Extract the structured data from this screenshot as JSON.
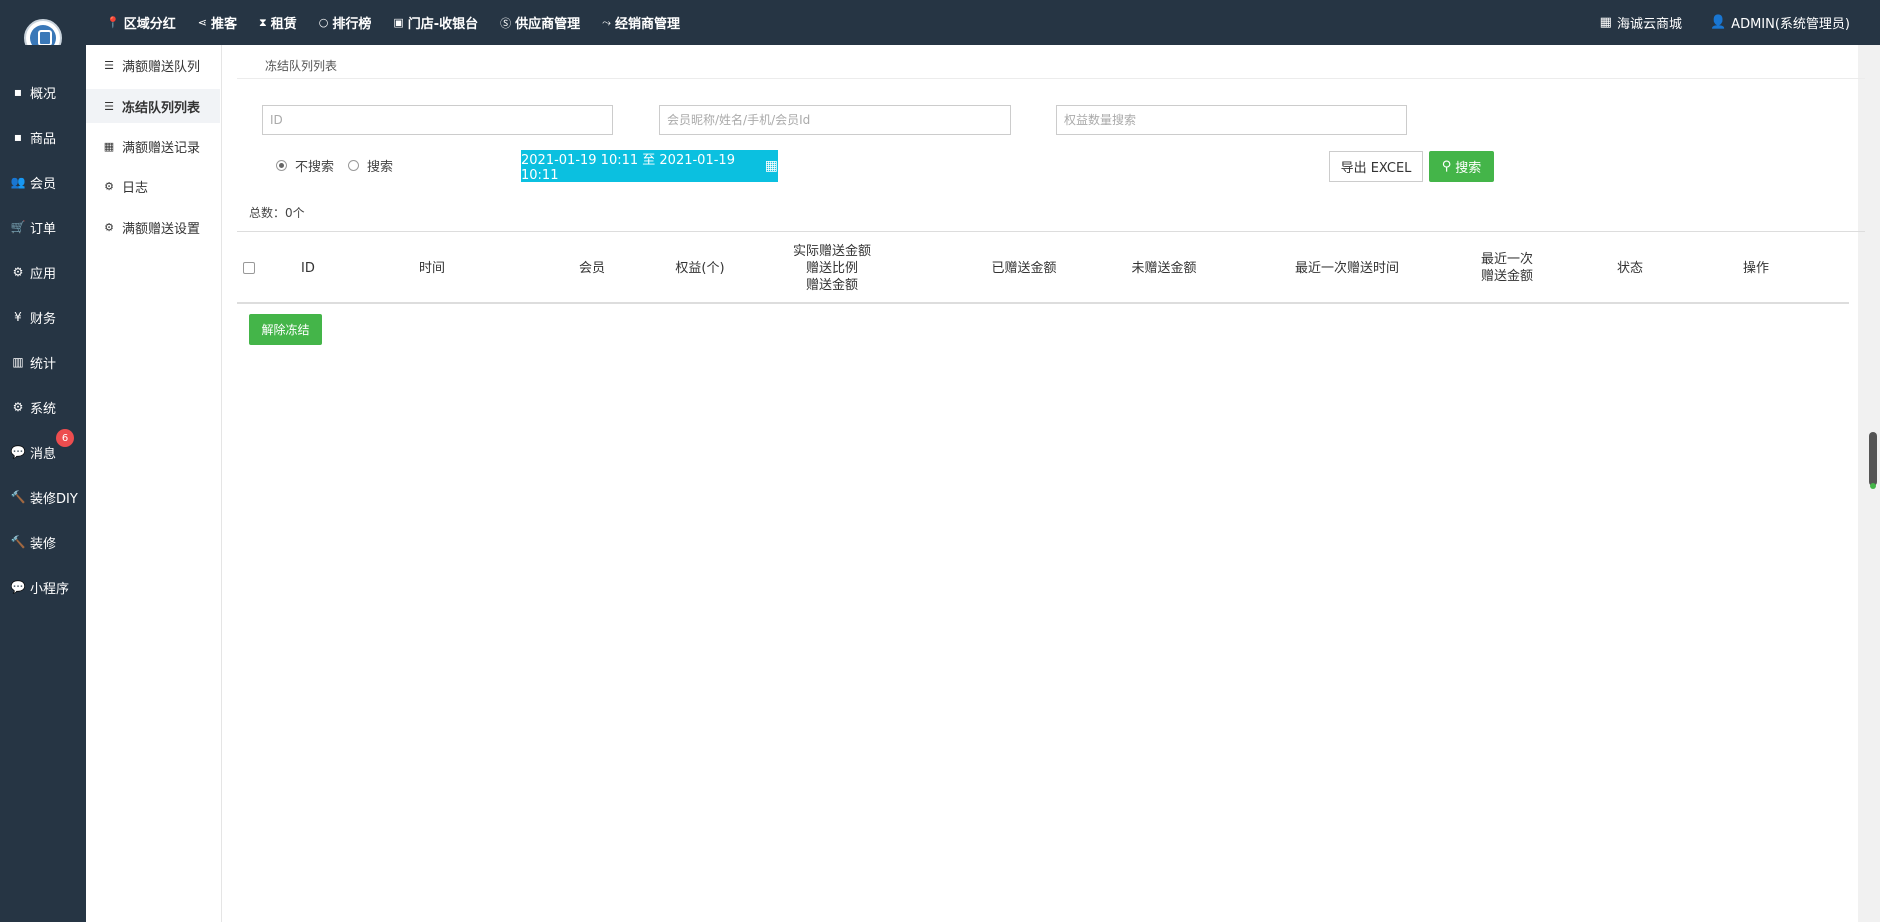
{
  "topnav": [
    {
      "icon": "📍",
      "icon_name": "pin-icon",
      "label": "区域分红"
    },
    {
      "icon": "⋖",
      "icon_name": "share-icon",
      "label": "推客"
    },
    {
      "icon": "⧗",
      "icon_name": "hourglass-icon",
      "label": "租赁"
    },
    {
      "icon": "○",
      "icon_name": "circle-icon",
      "label": "排行榜"
    },
    {
      "icon": "▣",
      "icon_name": "cashier-icon",
      "label": "门店-收银台"
    },
    {
      "icon": "Ⓢ",
      "icon_name": "skype-icon",
      "label": "供应商管理"
    },
    {
      "icon": "⤳",
      "icon_name": "handshake-icon",
      "label": "经销商管理"
    }
  ],
  "topright": {
    "store": {
      "icon": "▦",
      "label": "海诚云商城"
    },
    "user": {
      "icon": "👤",
      "label": "ADMIN(系统管理员)"
    }
  },
  "sidebar": [
    {
      "icon": "▪",
      "icon_name": "dashboard-icon",
      "label": "概况"
    },
    {
      "icon": "▪",
      "icon_name": "goods-icon",
      "label": "商品"
    },
    {
      "icon": "👥",
      "icon_name": "users-icon",
      "label": "会员"
    },
    {
      "icon": "🛒",
      "icon_name": "cart-icon",
      "label": "订单"
    },
    {
      "icon": "⚙",
      "icon_name": "apps-icon",
      "label": "应用"
    },
    {
      "icon": "¥",
      "icon_name": "yen-icon",
      "label": "财务"
    },
    {
      "icon": "▥",
      "icon_name": "chart-icon",
      "label": "统计"
    },
    {
      "icon": "⚙",
      "icon_name": "cogs-icon",
      "label": "系统"
    },
    {
      "icon": "💬",
      "icon_name": "message-icon",
      "label": "消息",
      "badge": "6"
    },
    {
      "icon": "🔨",
      "icon_name": "hammer-icon",
      "label": "装修DIY"
    },
    {
      "icon": "🔨",
      "icon_name": "hammer-icon",
      "label": "装修"
    },
    {
      "icon": "💬",
      "icon_name": "wechat-icon",
      "label": "小程序"
    }
  ],
  "submenu": [
    {
      "icon": "☰",
      "icon_name": "database-icon",
      "label": "满额赠送队列"
    },
    {
      "icon": "☰",
      "icon_name": "database-icon",
      "label": "冻结队列列表",
      "active": true
    },
    {
      "icon": "▦",
      "icon_name": "calendar-icon",
      "label": "满额赠送记录"
    },
    {
      "icon": "⚙",
      "icon_name": "cogs-icon",
      "label": "日志"
    },
    {
      "icon": "⚙",
      "icon_name": "cogs-icon",
      "label": "满额赠送设置"
    }
  ],
  "page": {
    "breadcrumb": "冻结队列列表",
    "filters": {
      "id_placeholder": "ID",
      "member_placeholder": "会员昵称/姓名/手机/会员Id",
      "equity_placeholder": "权益数量搜索"
    },
    "radio": {
      "no_search": "不搜索",
      "search": "搜索"
    },
    "date_range": "2021-01-19 10:11 至 2021-01-19 10:11",
    "export_label": "导出 EXCEL",
    "search_label": "搜索",
    "total": "总数：0个",
    "table_headers": [
      "ID",
      "时间",
      "会员",
      "权益(个)",
      "实际赠送金额\n赠送比例\n赠送金额",
      "已赠送金额",
      "未赠送金额",
      "最近一次赠送时间",
      "最近一次\n赠送金额",
      "状态",
      "操作"
    ],
    "unfreeze_label": "解除冻结"
  }
}
